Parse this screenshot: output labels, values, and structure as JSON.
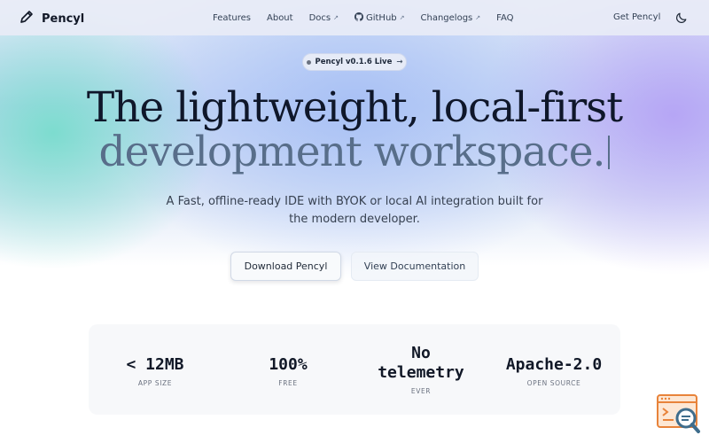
{
  "brand": {
    "name": "Pencyl",
    "icon": "pencil-icon"
  },
  "nav": {
    "links": [
      {
        "label": "Features",
        "external": false
      },
      {
        "label": "About",
        "external": false
      },
      {
        "label": "Docs",
        "external": true
      },
      {
        "label": "GitHub",
        "external": true,
        "icon": "github-icon"
      },
      {
        "label": "Changelogs",
        "external": true
      },
      {
        "label": "FAQ",
        "external": false
      }
    ],
    "cta": "Get Pencyl",
    "theme_toggle_icon": "moon-icon"
  },
  "badge": {
    "label": "Pencyl v0.1.6 Live",
    "arrow": "→"
  },
  "hero": {
    "line1": "The lightweight, local-first",
    "line2": "development workspace.",
    "sub_line1": "A Fast, offline-ready IDE with BYOK or local AI integration built for",
    "sub_line2": "the modern developer."
  },
  "buttons": {
    "primary": "Download Pencyl",
    "secondary": "View Documentation"
  },
  "stats": [
    {
      "value": "< 12MB",
      "caption": "APP SIZE"
    },
    {
      "value": "100%",
      "caption": "FREE"
    },
    {
      "value_line1": "No",
      "value_line2": "telemetry",
      "caption": "EVER"
    },
    {
      "value": "Apache-2.0",
      "caption": "OPEN SOURCE"
    }
  ],
  "colors": {
    "heading": "#0f172a",
    "heading_muted": "#586e8a",
    "accent_widget": "#e8833a"
  }
}
